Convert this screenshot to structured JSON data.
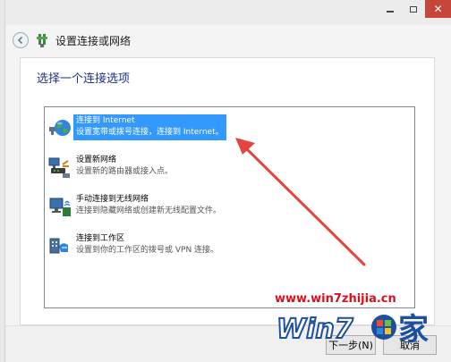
{
  "window": {
    "controls": {
      "minimize": "minimize",
      "maximize": "maximize",
      "close": "close"
    }
  },
  "header": {
    "title": "设置连接或网络"
  },
  "main": {
    "heading": "选择一个连接选项",
    "options": [
      {
        "icon": "globe-network-icon",
        "title": "连接到 Internet",
        "desc": "设置宽带或拨号连接，连接到 Internet。",
        "selected": true
      },
      {
        "icon": "router-computers-icon",
        "title": "设置新网络",
        "desc": "设置新的路由器或接入点。",
        "selected": false
      },
      {
        "icon": "wireless-computer-icon",
        "title": "手动连接到无线网络",
        "desc": "连接到隐藏网络或创建新无线配置文件。",
        "selected": false
      },
      {
        "icon": "workplace-vpn-icon",
        "title": "连接到工作区",
        "desc": "设置到你的工作区的拨号或 VPN 连接。",
        "selected": false
      }
    ]
  },
  "footer": {
    "next_label": "下一步(N)",
    "cancel_label": "取消"
  },
  "watermark": {
    "url": "www.win7zhijia.cn",
    "logo_text": "Win7",
    "logo_char": "家"
  },
  "colors": {
    "selection": "#3399ff",
    "heading": "#1e3287",
    "arrow": "#e2463e",
    "close_button": "#c7463a",
    "watermark_red": "#d8101c",
    "watermark_blue": "#1c4fa0"
  }
}
